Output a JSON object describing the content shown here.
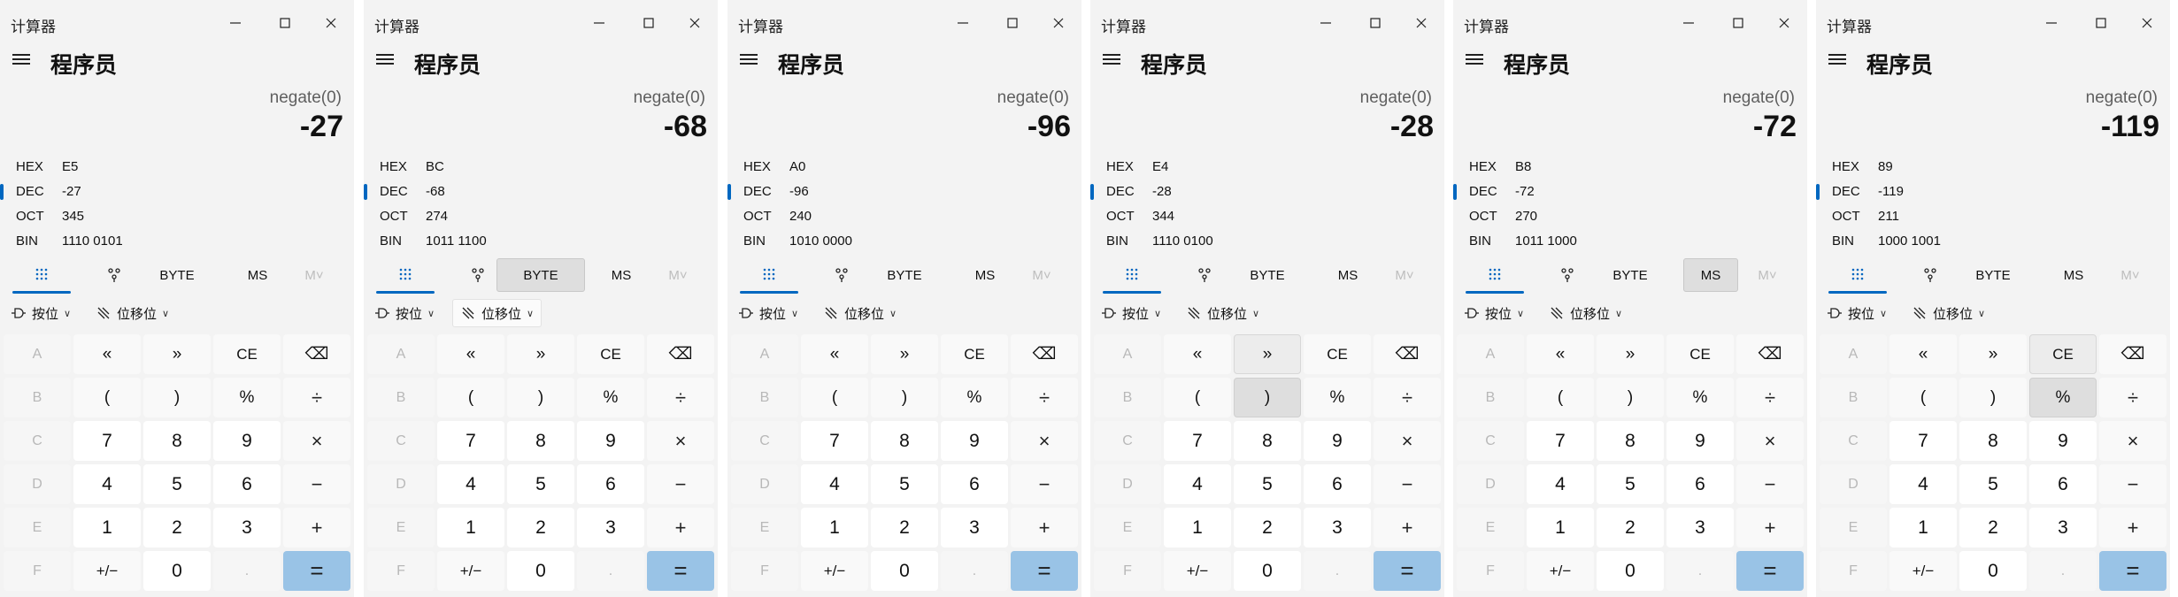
{
  "app": {
    "title": "计算器",
    "mode": "程序员"
  },
  "labels": {
    "hex": "HEX",
    "dec": "DEC",
    "oct": "OCT",
    "bin": "BIN",
    "word_size": "BYTE",
    "memory_store": "MS",
    "memory_recall": "M˅",
    "bitwise": "按位",
    "bit_shift": "位移位"
  },
  "keys": [
    {
      "label": "A",
      "kind": "disabled"
    },
    {
      "label": "«",
      "kind": "fn"
    },
    {
      "label": "»",
      "kind": "fn"
    },
    {
      "label": "CE",
      "kind": "fn"
    },
    {
      "label": "⌫",
      "kind": "fn"
    },
    {
      "label": "B",
      "kind": "disabled"
    },
    {
      "label": "(",
      "kind": "fn"
    },
    {
      "label": ")",
      "kind": "fn"
    },
    {
      "label": "%",
      "kind": "fn"
    },
    {
      "label": "÷",
      "kind": "op"
    },
    {
      "label": "C",
      "kind": "disabled"
    },
    {
      "label": "7",
      "kind": "num"
    },
    {
      "label": "8",
      "kind": "num"
    },
    {
      "label": "9",
      "kind": "num"
    },
    {
      "label": "×",
      "kind": "op"
    },
    {
      "label": "D",
      "kind": "disabled"
    },
    {
      "label": "4",
      "kind": "num"
    },
    {
      "label": "5",
      "kind": "num"
    },
    {
      "label": "6",
      "kind": "num"
    },
    {
      "label": "−",
      "kind": "op"
    },
    {
      "label": "E",
      "kind": "disabled"
    },
    {
      "label": "1",
      "kind": "num"
    },
    {
      "label": "2",
      "kind": "num"
    },
    {
      "label": "3",
      "kind": "num"
    },
    {
      "label": "+",
      "kind": "op"
    },
    {
      "label": "F",
      "kind": "disabled"
    },
    {
      "label": "+/−",
      "kind": "fn"
    },
    {
      "label": "0",
      "kind": "num"
    },
    {
      "label": ".",
      "kind": "disabled"
    },
    {
      "label": "=",
      "kind": "equal"
    }
  ],
  "calculators": [
    {
      "expression": "negate(0)",
      "result": "-27",
      "hex": "E5",
      "dec": "-27",
      "oct": "345",
      "bin": "1110 0101"
    },
    {
      "expression": "negate(0)",
      "result": "-68",
      "hex": "BC",
      "dec": "-68",
      "oct": "274",
      "bin": "1011 1100"
    },
    {
      "expression": "negate(0)",
      "result": "-96",
      "hex": "A0",
      "dec": "-96",
      "oct": "240",
      "bin": "1010 0000"
    },
    {
      "expression": "negate(0)",
      "result": "-28",
      "hex": "E4",
      "dec": "-28",
      "oct": "344",
      "bin": "1110 0100"
    },
    {
      "expression": "negate(0)",
      "result": "-72",
      "hex": "B8",
      "dec": "-72",
      "oct": "270",
      "bin": "1011 1000"
    },
    {
      "expression": "negate(0)",
      "result": "-119",
      "hex": "89",
      "dec": "-119",
      "oct": "211",
      "bin": "1000 1001"
    }
  ]
}
